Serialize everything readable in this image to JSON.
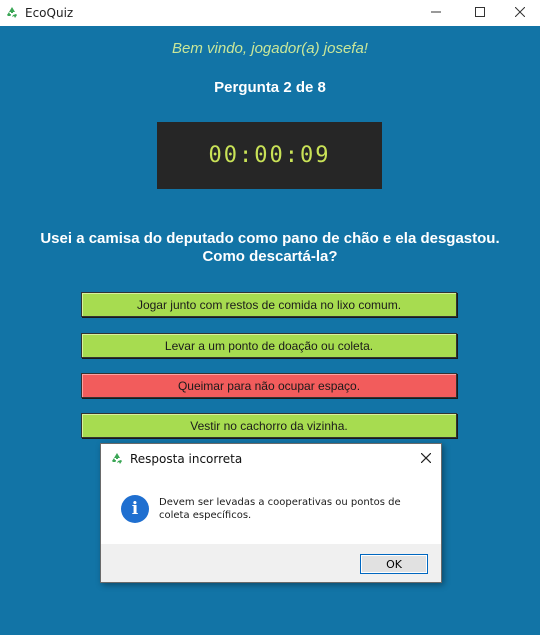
{
  "window": {
    "title": "EcoQuiz",
    "icon": "recycle-icon",
    "controls": {
      "minimize": "minimize-icon",
      "maximize": "maximize-icon",
      "close": "close-icon"
    }
  },
  "welcome_text": "Bem vindo, jogador(a) josefa!",
  "question_counter": "Pergunta 2 de 8",
  "timer": "00:00:09",
  "question": {
    "line1": "Usei a camisa do deputado como pano de chão e ela desgastou.",
    "line2": "Como descartá-la?"
  },
  "answers": [
    {
      "label": "Jogar junto com restos de comida no lixo comum.",
      "state": "default",
      "color": "#a7dc50"
    },
    {
      "label": "Levar a um ponto de doação ou coleta.",
      "state": "default",
      "color": "#a7dc50"
    },
    {
      "label": "Queimar para não ocupar espaço.",
      "state": "incorrect",
      "color": "#f25c5c"
    },
    {
      "label": "Vestir no cachorro da vizinha.",
      "state": "default",
      "color": "#a7dc50"
    }
  ],
  "dialog": {
    "title": "Resposta incorreta",
    "icon": "info-icon",
    "message": "Devem ser levadas a cooperativas ou pontos de coleta específicos.",
    "ok_label": "OK"
  },
  "colors": {
    "background": "#1274a6",
    "welcome_text": "#c9e79a",
    "timer_bg": "#262626",
    "timer_text": "#c9e257",
    "answer_default": "#a7dc50",
    "answer_incorrect": "#f25c5c",
    "info_icon": "#1f6fd0"
  }
}
